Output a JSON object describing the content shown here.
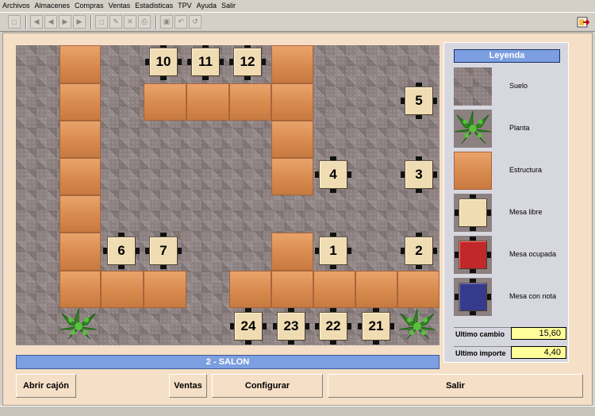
{
  "menu": [
    "Archivos",
    "Almacenes",
    "Compras",
    "Ventas",
    "Estadisticas",
    "TPV",
    "Ayuda",
    "Salir"
  ],
  "room_title": "2 - SALON",
  "tables": [
    {
      "label": "10",
      "state": "libre"
    },
    {
      "label": "11",
      "state": "libre"
    },
    {
      "label": "12",
      "state": "libre"
    },
    {
      "label": "5",
      "state": "libre"
    },
    {
      "label": "4",
      "state": "libre"
    },
    {
      "label": "3",
      "state": "libre"
    },
    {
      "label": "6",
      "state": "libre"
    },
    {
      "label": "7",
      "state": "libre"
    },
    {
      "label": "1",
      "state": "libre"
    },
    {
      "label": "2",
      "state": "libre"
    },
    {
      "label": "24",
      "state": "libre"
    },
    {
      "label": "23",
      "state": "libre"
    },
    {
      "label": "22",
      "state": "libre"
    },
    {
      "label": "21",
      "state": "libre"
    }
  ],
  "legend": {
    "title": "Leyenda",
    "items": [
      {
        "label": "Suelo",
        "icon": "floor-tile"
      },
      {
        "label": "Planta",
        "icon": "plant"
      },
      {
        "label": "Estructura",
        "icon": "wood-structure"
      },
      {
        "label": "Mesa libre",
        "color": "#f0dcb3"
      },
      {
        "label": "Mesa ocupada",
        "color": "#c0282a"
      },
      {
        "label": "Mesa con nota",
        "color": "#363a8c"
      }
    ]
  },
  "info": {
    "ultimo_cambio_label": "Ultimo cambio",
    "ultimo_cambio_value": "15,60",
    "ultimo_importe_label": "Ultimo importe",
    "ultimo_importe_value": "4,40"
  },
  "buttons": {
    "abrir": "Abrir cajón",
    "ventas": "Ventas",
    "configurar": "Configurar",
    "salir": "Salir"
  }
}
